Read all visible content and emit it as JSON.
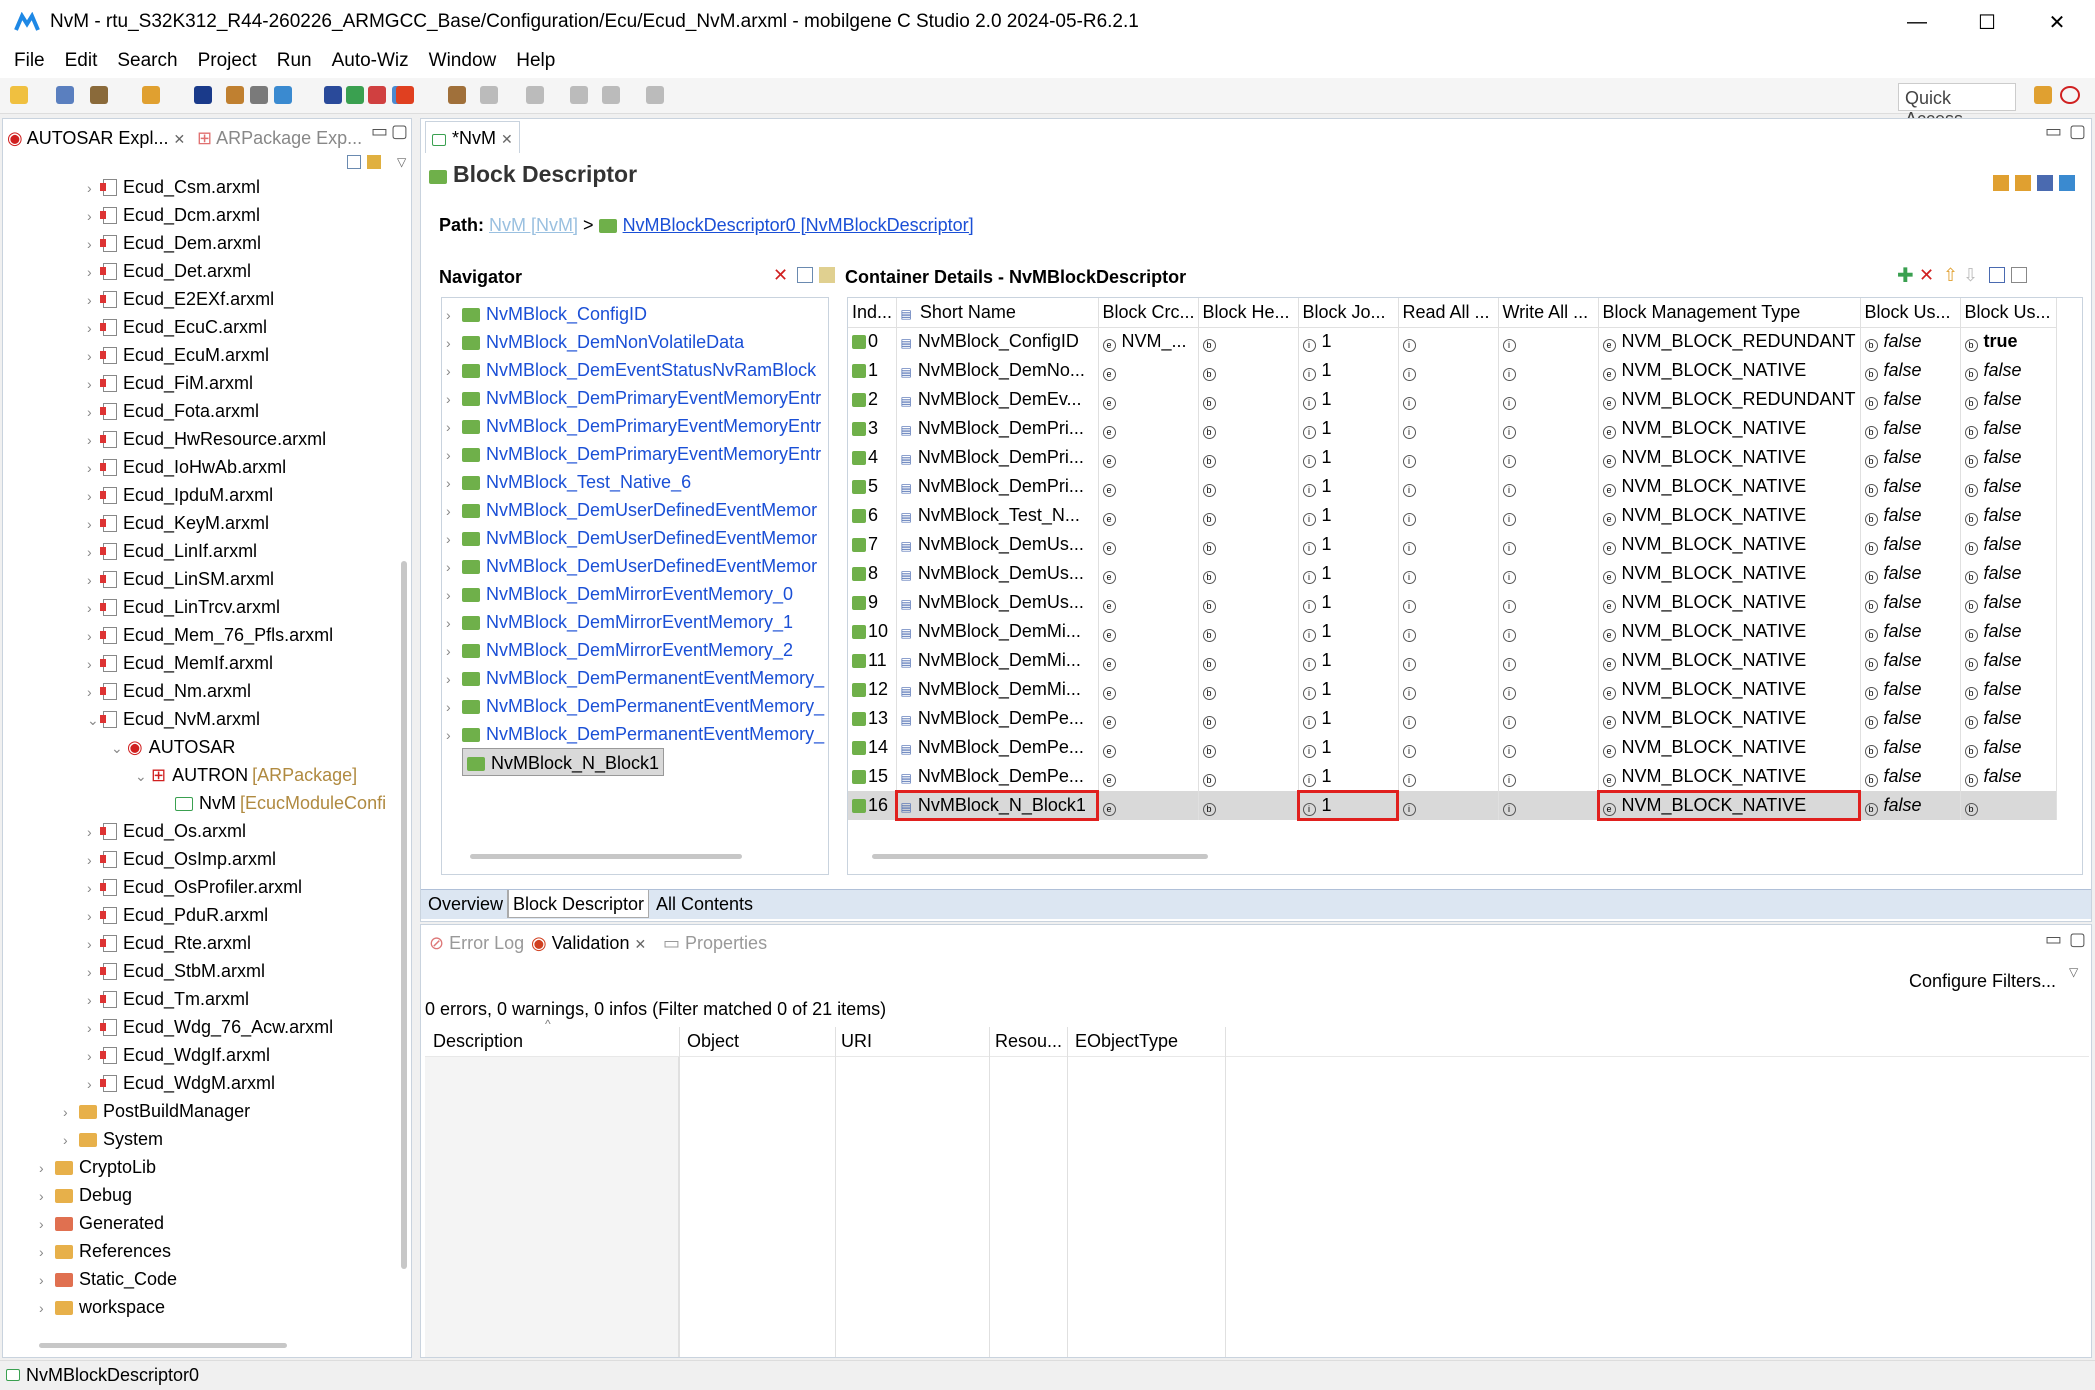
{
  "window": {
    "title": "NvM - rtu_S32K312_R44-260226_ARMGCC_Base/Configuration/Ecu/Ecud_NvM.arxml - mobilgene C Studio 2.0 2024-05-R6.2.1",
    "minimize": "—",
    "maximize": "☐",
    "close": "✕"
  },
  "menu": [
    "File",
    "Edit",
    "Search",
    "Project",
    "Run",
    "Auto-Wiz",
    "Window",
    "Help"
  ],
  "quick_access": "Quick Access",
  "left_panel": {
    "tab1": "AUTOSAR Expl...",
    "tab2": "ARPackage Exp...",
    "tree": [
      {
        "label": "Ecud_Csm.arxml",
        "type": "file",
        "indent": 1
      },
      {
        "label": "Ecud_Dcm.arxml",
        "type": "file",
        "indent": 1
      },
      {
        "label": "Ecud_Dem.arxml",
        "type": "file",
        "indent": 1
      },
      {
        "label": "Ecud_Det.arxml",
        "type": "file",
        "indent": 1
      },
      {
        "label": "Ecud_E2EXf.arxml",
        "type": "file",
        "indent": 1
      },
      {
        "label": "Ecud_EcuC.arxml",
        "type": "file",
        "indent": 1
      },
      {
        "label": "Ecud_EcuM.arxml",
        "type": "file",
        "indent": 1
      },
      {
        "label": "Ecud_FiM.arxml",
        "type": "file",
        "indent": 1
      },
      {
        "label": "Ecud_Fota.arxml",
        "type": "file",
        "indent": 1
      },
      {
        "label": "Ecud_HwResource.arxml",
        "type": "file",
        "indent": 1
      },
      {
        "label": "Ecud_IoHwAb.arxml",
        "type": "file",
        "indent": 1
      },
      {
        "label": "Ecud_IpduM.arxml",
        "type": "file",
        "indent": 1
      },
      {
        "label": "Ecud_KeyM.arxml",
        "type": "file",
        "indent": 1
      },
      {
        "label": "Ecud_LinIf.arxml",
        "type": "file",
        "indent": 1
      },
      {
        "label": "Ecud_LinSM.arxml",
        "type": "file",
        "indent": 1
      },
      {
        "label": "Ecud_LinTrcv.arxml",
        "type": "file",
        "indent": 1
      },
      {
        "label": "Ecud_Mem_76_Pfls.arxml",
        "type": "file",
        "indent": 1
      },
      {
        "label": "Ecud_MemIf.arxml",
        "type": "file",
        "indent": 1
      },
      {
        "label": "Ecud_Nm.arxml",
        "type": "file",
        "indent": 1
      },
      {
        "label": "Ecud_NvM.arxml",
        "type": "file-open",
        "indent": 1
      },
      {
        "label": "AUTOSAR",
        "type": "autosar",
        "indent": 2
      },
      {
        "label": "AUTRON",
        "suffix": "[ARPackage]",
        "type": "package",
        "indent": 3
      },
      {
        "label": "NvM",
        "suffix": "[EcucModuleConfi",
        "type": "module",
        "indent": 4
      },
      {
        "label": "Ecud_Os.arxml",
        "type": "file",
        "indent": 1
      },
      {
        "label": "Ecud_OsImp.arxml",
        "type": "file",
        "indent": 1
      },
      {
        "label": "Ecud_OsProfiler.arxml",
        "type": "file",
        "indent": 1
      },
      {
        "label": "Ecud_PduR.arxml",
        "type": "file",
        "indent": 1
      },
      {
        "label": "Ecud_Rte.arxml",
        "type": "file",
        "indent": 1
      },
      {
        "label": "Ecud_StbM.arxml",
        "type": "file",
        "indent": 1
      },
      {
        "label": "Ecud_Tm.arxml",
        "type": "file",
        "indent": 1
      },
      {
        "label": "Ecud_Wdg_76_Acw.arxml",
        "type": "file",
        "indent": 1
      },
      {
        "label": "Ecud_WdgIf.arxml",
        "type": "file",
        "indent": 1
      },
      {
        "label": "Ecud_WdgM.arxml",
        "type": "file",
        "indent": 1
      },
      {
        "label": "PostBuildManager",
        "type": "folder",
        "indent": 0
      },
      {
        "label": "System",
        "type": "folder",
        "indent": 0
      },
      {
        "label": "CryptoLib",
        "type": "folder",
        "indent": -1
      },
      {
        "label": "Debug",
        "type": "folder",
        "indent": -1
      },
      {
        "label": "Generated",
        "type": "folder-red",
        "indent": -1
      },
      {
        "label": "References",
        "type": "folder",
        "indent": -1
      },
      {
        "label": "Static_Code",
        "type": "folder-red",
        "indent": -1
      },
      {
        "label": "workspace",
        "type": "folder",
        "indent": -1
      }
    ]
  },
  "editor": {
    "tab": "*NvM",
    "heading": "Block Descriptor",
    "path_label": "Path:",
    "path_root": "NvM [NvM]",
    "path_sep": ">",
    "path_current": "NvMBlockDescriptor0 [NvMBlockDescriptor]",
    "navigator_title": "Navigator",
    "navigator_items": [
      "NvMBlock_ConfigID",
      "NvMBlock_DemNonVolatileData",
      "NvMBlock_DemEventStatusNvRamBlock",
      "NvMBlock_DemPrimaryEventMemoryEntr",
      "NvMBlock_DemPrimaryEventMemoryEntr",
      "NvMBlock_DemPrimaryEventMemoryEntr",
      "NvMBlock_Test_Native_6",
      "NvMBlock_DemUserDefinedEventMemor",
      "NvMBlock_DemUserDefinedEventMemor",
      "NvMBlock_DemUserDefinedEventMemor",
      "NvMBlock_DemMirrorEventMemory_0",
      "NvMBlock_DemMirrorEventMemory_1",
      "NvMBlock_DemMirrorEventMemory_2",
      "NvMBlock_DemPermanentEventMemory_",
      "NvMBlock_DemPermanentEventMemory_",
      "NvMBlock_DemPermanentEventMemory_"
    ],
    "navigator_selected": "NvMBlock_N_Block1",
    "details_title": "Container Details - NvMBlockDescriptor",
    "columns": [
      "Ind...",
      "Short Name",
      "Block Crc...",
      "Block He...",
      "Block Jo...",
      "Read All ...",
      "Write All ...",
      "Block Management Type",
      "Block Us...",
      "Block Us..."
    ],
    "rows": [
      {
        "idx": "0",
        "name": "NvMBlock_ConfigID",
        "crc": "NVM_...",
        "jo": "1",
        "mgmt": "NVM_BLOCK_REDUNDANT",
        "us1": "false",
        "us2": "true"
      },
      {
        "idx": "1",
        "name": "NvMBlock_DemNo...",
        "crc": "",
        "jo": "1",
        "mgmt": "NVM_BLOCK_NATIVE",
        "us1": "false",
        "us2": "false"
      },
      {
        "idx": "2",
        "name": "NvMBlock_DemEv...",
        "crc": "",
        "jo": "1",
        "mgmt": "NVM_BLOCK_REDUNDANT",
        "us1": "false",
        "us2": "false"
      },
      {
        "idx": "3",
        "name": "NvMBlock_DemPri...",
        "crc": "",
        "jo": "1",
        "mgmt": "NVM_BLOCK_NATIVE",
        "us1": "false",
        "us2": "false"
      },
      {
        "idx": "4",
        "name": "NvMBlock_DemPri...",
        "crc": "",
        "jo": "1",
        "mgmt": "NVM_BLOCK_NATIVE",
        "us1": "false",
        "us2": "false"
      },
      {
        "idx": "5",
        "name": "NvMBlock_DemPri...",
        "crc": "",
        "jo": "1",
        "mgmt": "NVM_BLOCK_NATIVE",
        "us1": "false",
        "us2": "false"
      },
      {
        "idx": "6",
        "name": "NvMBlock_Test_N...",
        "crc": "",
        "jo": "1",
        "mgmt": "NVM_BLOCK_NATIVE",
        "us1": "false",
        "us2": "false"
      },
      {
        "idx": "7",
        "name": "NvMBlock_DemUs...",
        "crc": "",
        "jo": "1",
        "mgmt": "NVM_BLOCK_NATIVE",
        "us1": "false",
        "us2": "false"
      },
      {
        "idx": "8",
        "name": "NvMBlock_DemUs...",
        "crc": "",
        "jo": "1",
        "mgmt": "NVM_BLOCK_NATIVE",
        "us1": "false",
        "us2": "false"
      },
      {
        "idx": "9",
        "name": "NvMBlock_DemUs...",
        "crc": "",
        "jo": "1",
        "mgmt": "NVM_BLOCK_NATIVE",
        "us1": "false",
        "us2": "false"
      },
      {
        "idx": "10",
        "name": "NvMBlock_DemMi...",
        "crc": "",
        "jo": "1",
        "mgmt": "NVM_BLOCK_NATIVE",
        "us1": "false",
        "us2": "false"
      },
      {
        "idx": "11",
        "name": "NvMBlock_DemMi...",
        "crc": "",
        "jo": "1",
        "mgmt": "NVM_BLOCK_NATIVE",
        "us1": "false",
        "us2": "false"
      },
      {
        "idx": "12",
        "name": "NvMBlock_DemMi...",
        "crc": "",
        "jo": "1",
        "mgmt": "NVM_BLOCK_NATIVE",
        "us1": "false",
        "us2": "false"
      },
      {
        "idx": "13",
        "name": "NvMBlock_DemPe...",
        "crc": "",
        "jo": "1",
        "mgmt": "NVM_BLOCK_NATIVE",
        "us1": "false",
        "us2": "false"
      },
      {
        "idx": "14",
        "name": "NvMBlock_DemPe...",
        "crc": "",
        "jo": "1",
        "mgmt": "NVM_BLOCK_NATIVE",
        "us1": "false",
        "us2": "false"
      },
      {
        "idx": "15",
        "name": "NvMBlock_DemPe...",
        "crc": "",
        "jo": "1",
        "mgmt": "NVM_BLOCK_NATIVE",
        "us1": "false",
        "us2": "false"
      },
      {
        "idx": "16",
        "name": "NvMBlock_N_Block1",
        "crc": "",
        "jo": "1",
        "mgmt": "NVM_BLOCK_NATIVE",
        "us1": "false",
        "us2": ""
      }
    ],
    "bottom_tabs": [
      "Overview",
      "Block Descriptor",
      "All Contents"
    ]
  },
  "lower_panel": {
    "tabs": [
      "Error Log",
      "Validation",
      "Properties"
    ],
    "configure": "Configure Filters...",
    "summary": "0 errors, 0 warnings, 0 infos (Filter matched 0 of 21 items)",
    "columns": [
      "Description",
      "Object",
      "URI",
      "Resou...",
      "EObjectType"
    ]
  },
  "status_bar": "NvMBlockDescriptor0",
  "colors": {
    "highlight": "#e0201e",
    "link": "#1a4fd6",
    "selection": "#d9d9d9"
  }
}
